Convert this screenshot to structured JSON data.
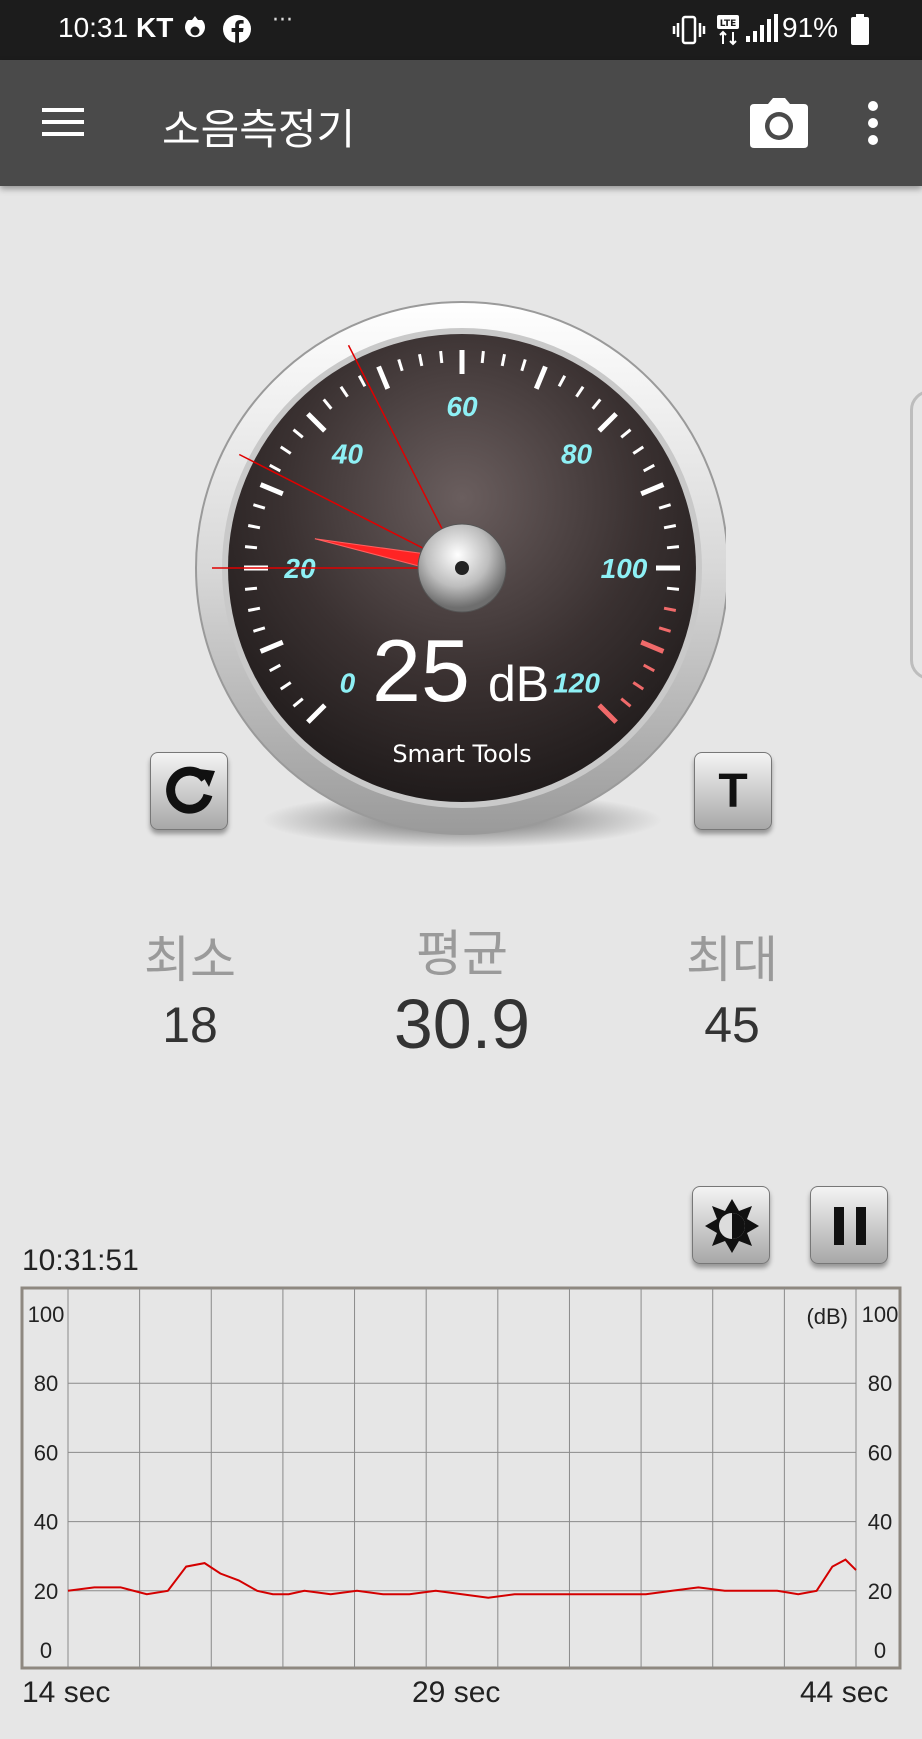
{
  "status_bar": {
    "time": "10:31",
    "carrier": "KT",
    "more": "···",
    "network": "LTE",
    "battery": "91%"
  },
  "app_bar": {
    "title": "소음측정기",
    "icons": [
      "menu-icon",
      "camera-icon",
      "more-vert-icon"
    ]
  },
  "gauge": {
    "value": "25",
    "unit": "dB",
    "brand": "Smart Tools",
    "needle_value": 25,
    "scale_labels": [
      "0",
      "20",
      "40",
      "60",
      "80",
      "100",
      "120"
    ],
    "marker_values": [
      20,
      32,
      48
    ],
    "reset_icon": "refresh-icon",
    "t_button_label": "T",
    "accent": "#ff2020",
    "label_color": "#8ef0f5"
  },
  "stats": {
    "min_label": "최소",
    "min_value": "18",
    "avg_label": "평균",
    "avg_value": "30.9",
    "max_label": "최대",
    "max_value": "45"
  },
  "chart_controls": {
    "timestamp": "10:31:51",
    "brightness_icon": "brightness-icon",
    "pause_icon": "pause-icon"
  },
  "chart_data": {
    "type": "line",
    "title": "",
    "unit_label": "(dB)",
    "xlabel": "",
    "ylabel": "",
    "x_tick_labels": [
      "14 sec",
      "29 sec",
      "44 sec"
    ],
    "y_ticks": [
      0,
      20,
      40,
      60,
      80,
      100
    ],
    "xlim": [
      14,
      44
    ],
    "ylim": [
      0,
      100
    ],
    "grid": true,
    "line_color": "#d40000",
    "x": [
      14,
      15,
      16,
      17,
      17.8,
      18.5,
      19.2,
      19.8,
      20.5,
      21.2,
      21.8,
      22.4,
      23,
      24,
      25,
      26,
      27,
      28,
      29,
      30,
      31,
      32,
      33,
      34,
      35,
      36,
      37,
      38,
      39,
      40,
      41,
      41.8,
      42.5,
      43.1,
      43.6,
      44
    ],
    "y": [
      20,
      21,
      21,
      19,
      20,
      27,
      28,
      25,
      23,
      20,
      19,
      19,
      20,
      19,
      20,
      19,
      19,
      20,
      19,
      18,
      19,
      19,
      19,
      19,
      19,
      19,
      20,
      21,
      20,
      20,
      20,
      19,
      20,
      27,
      29,
      26
    ]
  }
}
